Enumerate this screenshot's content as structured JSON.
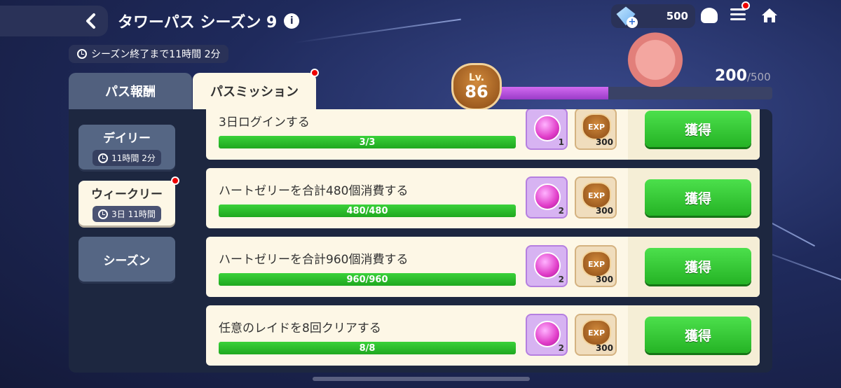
{
  "header": {
    "title": "タワーパス シーズン 9",
    "info_label": "i",
    "timer": "シーズン終了まで11時間 2分"
  },
  "currency": {
    "gems": "500",
    "plus": "+"
  },
  "level": {
    "lv_label": "Lv.",
    "value": "86",
    "xp_current": "200",
    "xp_max": "/500",
    "xp_fraction": 0.4
  },
  "tabs": [
    {
      "label": "パス報酬",
      "active": false
    },
    {
      "label": "パスミッション",
      "active": true
    }
  ],
  "sidebar": [
    {
      "label": "デイリー",
      "sub": "11時間 2分",
      "active": false
    },
    {
      "label": "ウィークリー",
      "sub": "3日 11時間",
      "active": true
    },
    {
      "label": "シーズン",
      "sub": null,
      "active": false
    }
  ],
  "missions": [
    {
      "name": "3日ログインする",
      "progress_text": "3/3",
      "progress": 1.0,
      "gem_qty": "1",
      "exp_qty": "300",
      "exp_label": "EXP",
      "claim_label": "獲得"
    },
    {
      "name": "ハートゼリーを合計480個消費する",
      "progress_text": "480/480",
      "progress": 1.0,
      "gem_qty": "2",
      "exp_qty": "300",
      "exp_label": "EXP",
      "claim_label": "獲得"
    },
    {
      "name": "ハートゼリーを合計960個消費する",
      "progress_text": "960/960",
      "progress": 1.0,
      "gem_qty": "2",
      "exp_qty": "300",
      "exp_label": "EXP",
      "claim_label": "獲得"
    },
    {
      "name": "任意のレイドを8回クリアする",
      "progress_text": "8/8",
      "progress": 1.0,
      "gem_qty": "2",
      "exp_qty": "300",
      "exp_label": "EXP",
      "claim_label": "獲得"
    }
  ],
  "icons": {
    "back": "chevron-left-icon",
    "info": "info-icon",
    "clock": "clock-icon",
    "gem": "gem-icon",
    "chef_hat": "chef-hat-icon",
    "menu": "menu-icon",
    "home": "home-icon"
  },
  "colors": {
    "claim_green": "#25b325",
    "xp_purple": "#c055e6",
    "notification_red": "#e00000",
    "panel_cream": "#fdf7e6"
  }
}
